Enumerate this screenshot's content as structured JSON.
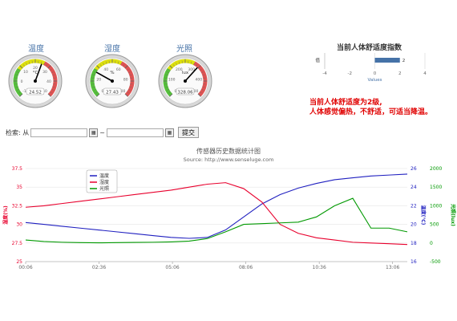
{
  "gauges": [
    {
      "title": "温度",
      "unit": "°C",
      "value_text": "24.52",
      "value": 24.52,
      "min": -10,
      "max": 50,
      "ticks": [
        "-10",
        "0",
        "10",
        "20",
        "30",
        "40",
        "50"
      ]
    },
    {
      "title": "湿度",
      "unit": "%",
      "value_text": "27.43",
      "value": 27.43,
      "min": 0,
      "max": 100,
      "ticks": [
        "0",
        "20",
        "40",
        "60",
        "80",
        "100"
      ]
    },
    {
      "title": "光照",
      "unit": "lux",
      "value_text": "328.06",
      "value": 328.06,
      "min": 0,
      "max": 500,
      "ticks": [
        "0",
        "100",
        "200",
        "300",
        "400",
        "500"
      ]
    }
  ],
  "comfort": {
    "title": "当前人体舒适度指数",
    "message_line1": "当前人体舒适度为2级,",
    "message_line2": "人体感觉偏热，不舒适，可适当降温。",
    "chart_data": {
      "type": "bar",
      "orientation": "horizontal",
      "categories": [
        "值"
      ],
      "values": [
        2
      ],
      "xlabel": "Values",
      "xlim": [
        -4,
        4
      ],
      "xticks": [
        "-4",
        "-2",
        "0",
        "2",
        "4"
      ],
      "data_label": "2",
      "color": "#4572A7"
    }
  },
  "search": {
    "label": "检索: 从",
    "separator": "~",
    "from_value": "",
    "to_value": "",
    "button_label": "提交"
  },
  "history": {
    "title": "传感器历史数据统计图",
    "subtitle": "Source: http://www.senseluge.com",
    "chart_data": {
      "type": "line",
      "x_ticks": [
        "00:06",
        "02:36",
        "05:06",
        "08:06",
        "10:36",
        "13:06"
      ],
      "legend": [
        "温度",
        "湿度",
        "光照"
      ],
      "axes": {
        "left": {
          "label": "湿度(%)",
          "range": [
            25,
            37.5
          ],
          "ticks": [
            "25",
            "27.5",
            "30",
            "32.5",
            "35",
            "37.5"
          ],
          "color": "#e8002d"
        },
        "right1": {
          "label": "温度(℃)",
          "range": [
            16,
            26
          ],
          "ticks": [
            "16",
            "18",
            "20",
            "22",
            "24",
            "26"
          ],
          "color": "#2020c0"
        },
        "right2": {
          "label": "光照(lux)",
          "range": [
            -500,
            2000
          ],
          "ticks": [
            "-500",
            "0",
            "500",
            "1000",
            "1500",
            "2000"
          ],
          "color": "#009900"
        }
      },
      "series": [
        {
          "name": "温度",
          "axis": "right1",
          "color": "#2020c0",
          "values": [
            20.2,
            20.0,
            19.8,
            19.6,
            19.4,
            19.2,
            19.0,
            18.8,
            18.6,
            18.5,
            18.6,
            19.4,
            20.8,
            22.2,
            23.2,
            23.9,
            24.4,
            24.8,
            25.0,
            25.2,
            25.3,
            25.4
          ]
        },
        {
          "name": "湿度",
          "axis": "left",
          "color": "#e8002d",
          "values": [
            32.3,
            32.5,
            32.8,
            33.1,
            33.4,
            33.7,
            34.0,
            34.3,
            34.6,
            35.0,
            35.4,
            35.6,
            34.8,
            33.0,
            30.0,
            28.8,
            28.2,
            27.9,
            27.6,
            27.5,
            27.4,
            27.3
          ]
        },
        {
          "name": "光照",
          "axis": "right2",
          "color": "#009900",
          "values": [
            80,
            40,
            20,
            10,
            5,
            10,
            15,
            20,
            30,
            50,
            120,
            300,
            500,
            520,
            540,
            560,
            700,
            1000,
            1200,
            400,
            400,
            300
          ]
        }
      ]
    }
  }
}
